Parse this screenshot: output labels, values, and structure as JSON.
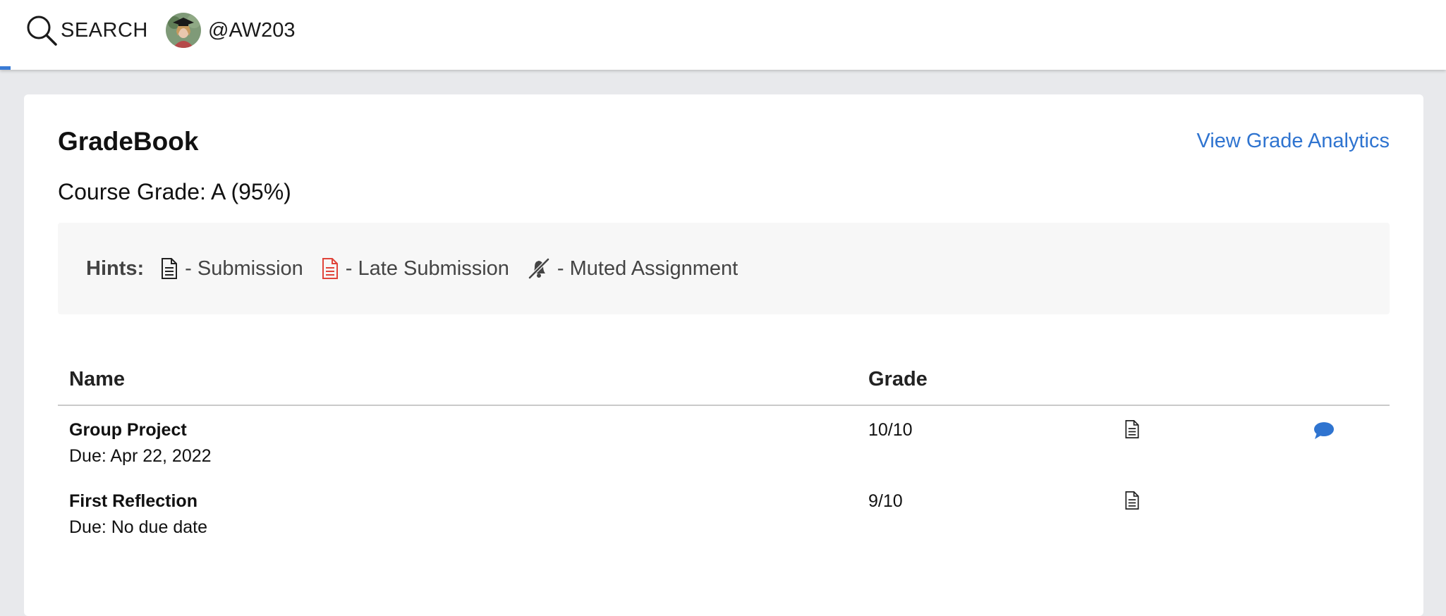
{
  "topbar": {
    "search_label": "SEARCH",
    "user_handle": "@AW203",
    "accent_color": "#3a7bd5"
  },
  "gradebook": {
    "title": "GradeBook",
    "analytics_link": "View Grade Analytics",
    "course_grade": "Course Grade: A (95%)"
  },
  "hints": {
    "title": "Hints:",
    "items": [
      {
        "icon": "document-icon",
        "label": "- Submission",
        "color": "#222222"
      },
      {
        "icon": "late-document-icon",
        "label": "- Late Submission",
        "color": "#e0443a"
      },
      {
        "icon": "muted-bell-icon",
        "label": "- Muted Assignment",
        "color": "#444444"
      }
    ]
  },
  "table": {
    "headers": {
      "name": "Name",
      "grade": "Grade"
    },
    "rows": [
      {
        "name": "Group Project",
        "due": "Due: Apr 22, 2022",
        "grade": "10/10",
        "submission_icon": "document-icon",
        "comment_icon": "comment-icon"
      },
      {
        "name": "First Reflection",
        "due": "Due: No due date",
        "grade": "9/10",
        "submission_icon": "document-icon"
      }
    ]
  },
  "colors": {
    "link": "#2f74d0",
    "comment": "#2f74d0",
    "late": "#e0443a"
  }
}
